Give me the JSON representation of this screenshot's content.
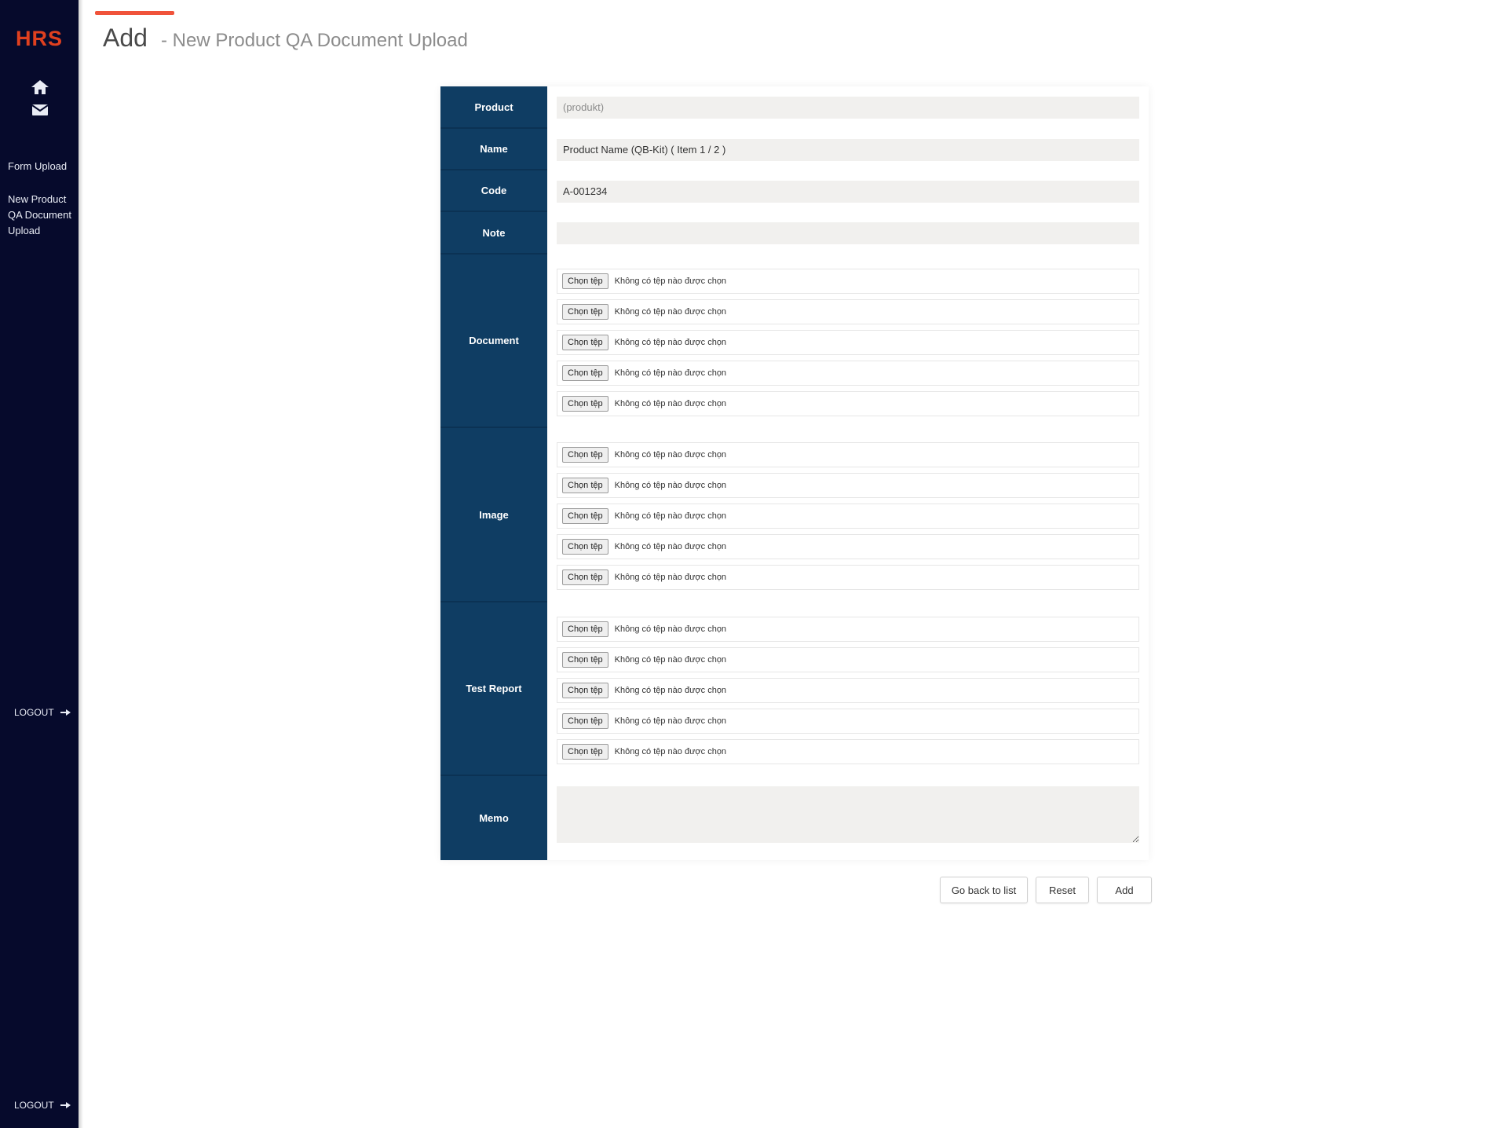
{
  "app": {
    "logo": "HRS"
  },
  "sidebar": {
    "icons": [
      "home-icon",
      "mail-icon"
    ],
    "links": [
      "Form Upload",
      "New Product QA Document Upload"
    ],
    "logout_label": "LOGOUT",
    "logout_bottom_label": "LOGOUT"
  },
  "header": {
    "title": "Add",
    "subtitle": "- New Product QA Document Upload"
  },
  "form": {
    "fields": [
      {
        "label": "Product",
        "value": "(produkt)"
      },
      {
        "label": "Name",
        "value": "Product Name (QB-Kit) ( Item 1 / 2 )"
      },
      {
        "label": "Code",
        "value": "A-001234"
      },
      {
        "label": "Note",
        "value": ""
      }
    ],
    "file_groups": [
      {
        "label": "Document",
        "files": [
          {
            "button": "Chọn tệp",
            "status": "Không có tệp nào được chọn"
          },
          {
            "button": "Chọn tệp",
            "status": "Không có tệp nào được chọn"
          },
          {
            "button": "Chọn tệp",
            "status": "Không có tệp nào được chọn"
          },
          {
            "button": "Chọn tệp",
            "status": "Không có tệp nào được chọn"
          },
          {
            "button": "Chọn tệp",
            "status": "Không có tệp nào được chọn"
          }
        ]
      },
      {
        "label": "Image",
        "files": [
          {
            "button": "Chọn tệp",
            "status": "Không có tệp nào được chọn"
          },
          {
            "button": "Chọn tệp",
            "status": "Không có tệp nào được chọn"
          },
          {
            "button": "Chọn tệp",
            "status": "Không có tệp nào được chọn"
          },
          {
            "button": "Chọn tệp",
            "status": "Không có tệp nào được chọn"
          },
          {
            "button": "Chọn tệp",
            "status": "Không có tệp nào được chọn"
          }
        ]
      },
      {
        "label": "Test Report",
        "files": [
          {
            "button": "Chọn tệp",
            "status": "Không có tệp nào được chọn"
          },
          {
            "button": "Chọn tệp",
            "status": "Không có tệp nào được chọn"
          },
          {
            "button": "Chọn tệp",
            "status": "Không có tệp nào được chọn"
          },
          {
            "button": "Chọn tệp",
            "status": "Không có tệp nào được chọn"
          },
          {
            "button": "Chọn tệp",
            "status": "Không có tệp nào được chọn"
          }
        ]
      }
    ],
    "memo": {
      "label": "Memo",
      "value": ""
    }
  },
  "actions": {
    "back_label": "Go back to list",
    "reset_label": "Reset",
    "add_label": "Add"
  },
  "colors": {
    "sidebar_bg": "#060a2c",
    "label_bg": "#0f3d63",
    "accent": "#f0533a",
    "logo": "#e0401f"
  }
}
